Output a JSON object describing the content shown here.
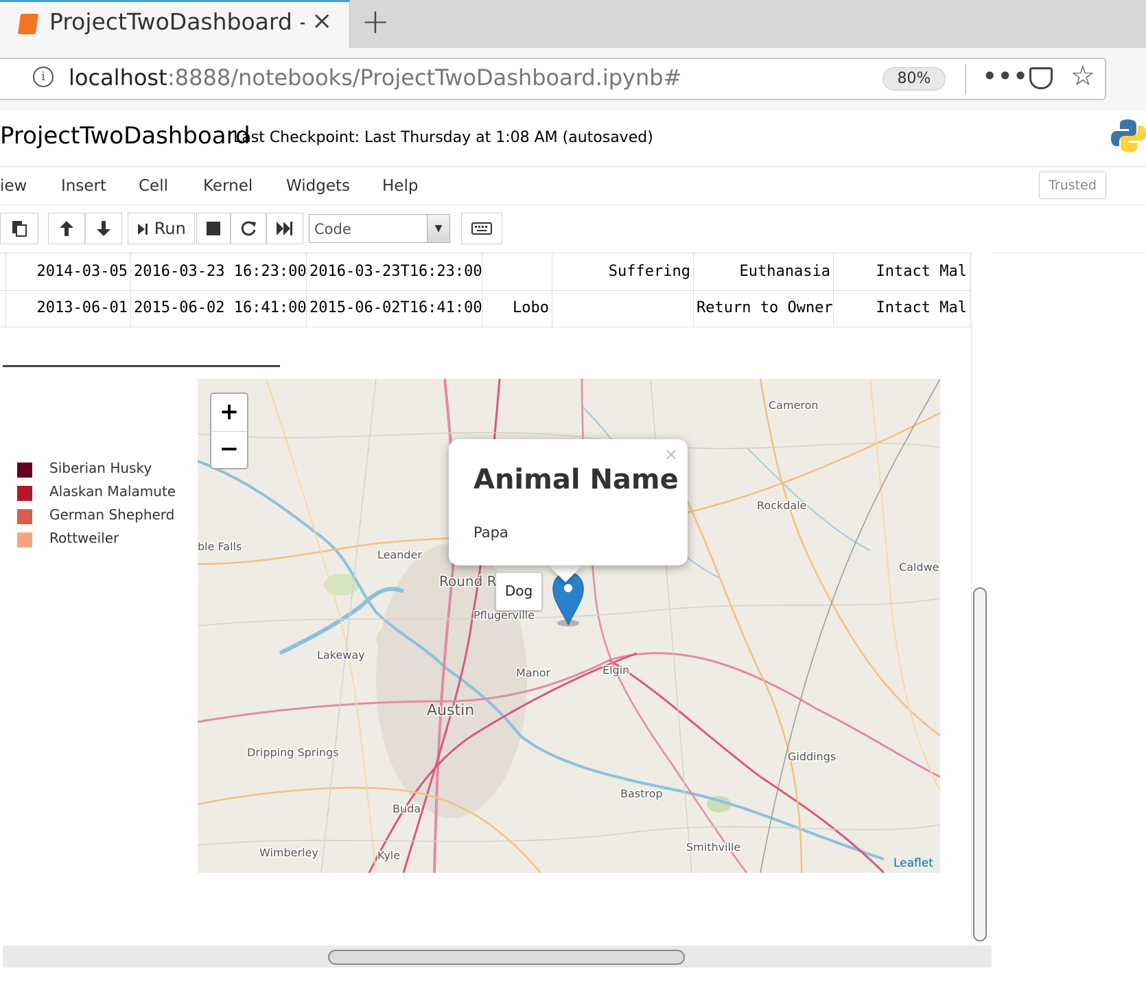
{
  "browser": {
    "tab_title": "ProjectTwoDashboard - Jupyter Notebook",
    "close_glyph": "×",
    "new_tab_glyph": "+",
    "url_host": "localhost",
    "url_path": ":8888/notebooks/ProjectTwoDashboard.ipynb#",
    "zoom": "80%",
    "info_glyph": "i",
    "more_glyph": "•••",
    "star_glyph": "☆"
  },
  "notebook": {
    "name": "ProjectTwoDashboard",
    "checkpoint": "Last Checkpoint: Last Thursday at 1:08 AM   (autosaved)",
    "trusted": "Trusted"
  },
  "menu": [
    "iew",
    "Insert",
    "Cell",
    "Kernel",
    "Widgets",
    "Help"
  ],
  "toolbar": {
    "run_label": "Run",
    "cell_type": "Code",
    "icons": [
      "paste-icon",
      "move-up-icon",
      "move-down-icon",
      "run-icon",
      "stop-icon",
      "restart-icon",
      "fast-forward-icon",
      "keyboard-icon"
    ]
  },
  "table": {
    "rows": [
      [
        "2014-03-05",
        "2016-03-23 16:23:00",
        "2016-03-23T16:23:00",
        "",
        "Suffering",
        "Euthanasia",
        "Intact Mal"
      ],
      [
        "2013-06-01",
        "2015-06-02 16:41:00",
        "2015-06-02T16:41:00",
        "Lobo",
        "",
        "Return to Owner",
        "Intact Mal"
      ]
    ]
  },
  "legend": {
    "items": [
      {
        "label": "Siberian Husky",
        "color": "#67001f"
      },
      {
        "label": "Alaskan Malamute",
        "color": "#b2182b"
      },
      {
        "label": "German Shepherd",
        "color": "#d6604d"
      },
      {
        "label": "Rottweiler",
        "color": "#f4a582"
      }
    ]
  },
  "map": {
    "zoom_in": "+",
    "zoom_out": "−",
    "popup_close": "×",
    "popup_title": "Animal Name",
    "popup_body": "Papa",
    "tooltip": "Dog",
    "attribution": "Leaflet",
    "marker_color": "#2a81cb",
    "places": [
      {
        "name": "Cameron"
      },
      {
        "name": "Rockdale"
      },
      {
        "name": "Caldwe"
      },
      {
        "name": "ble Falls"
      },
      {
        "name": "Leander"
      },
      {
        "name": "Round R"
      },
      {
        "name": "Pflugerville"
      },
      {
        "name": "Lakeway"
      },
      {
        "name": "Manor"
      },
      {
        "name": "Elgin"
      },
      {
        "name": "Austin"
      },
      {
        "name": "Dripping Springs"
      },
      {
        "name": "Giddings"
      },
      {
        "name": "Bastrop"
      },
      {
        "name": "Buda"
      },
      {
        "name": "Wimberley"
      },
      {
        "name": "Kyle"
      },
      {
        "name": "Smithville"
      }
    ]
  }
}
